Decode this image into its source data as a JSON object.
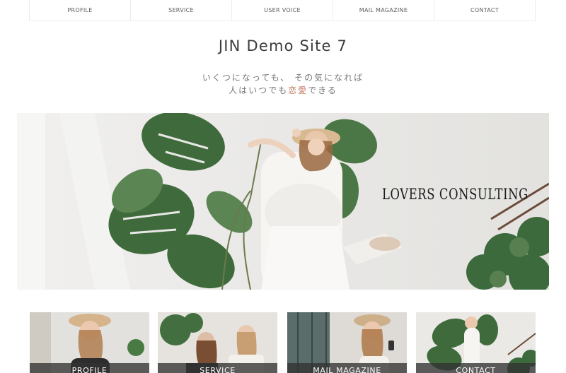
{
  "nav": {
    "items": [
      {
        "label": "PROFILE"
      },
      {
        "label": "SERVICE"
      },
      {
        "label": "USER VOICE"
      },
      {
        "label": "MAIL MAGAZINE"
      },
      {
        "label": "CONTACT"
      }
    ]
  },
  "header": {
    "site_title": "JIN Demo Site 7",
    "tagline_line1": "いくつになっても、 その気になれば",
    "tagline_line2_prefix": "人はいつでも",
    "tagline_line2_accent": "恋愛",
    "tagline_line2_suffix": "できる"
  },
  "hero": {
    "title": "LOVERS CONSULTING"
  },
  "cards": [
    {
      "label": "PROFILE"
    },
    {
      "label": "SERVICE"
    },
    {
      "label": "MAIL MAGAZINE"
    },
    {
      "label": "CONTACT"
    }
  ],
  "colors": {
    "accent": "#c47b62",
    "text": "#3c3c3c",
    "muted": "#777777"
  }
}
